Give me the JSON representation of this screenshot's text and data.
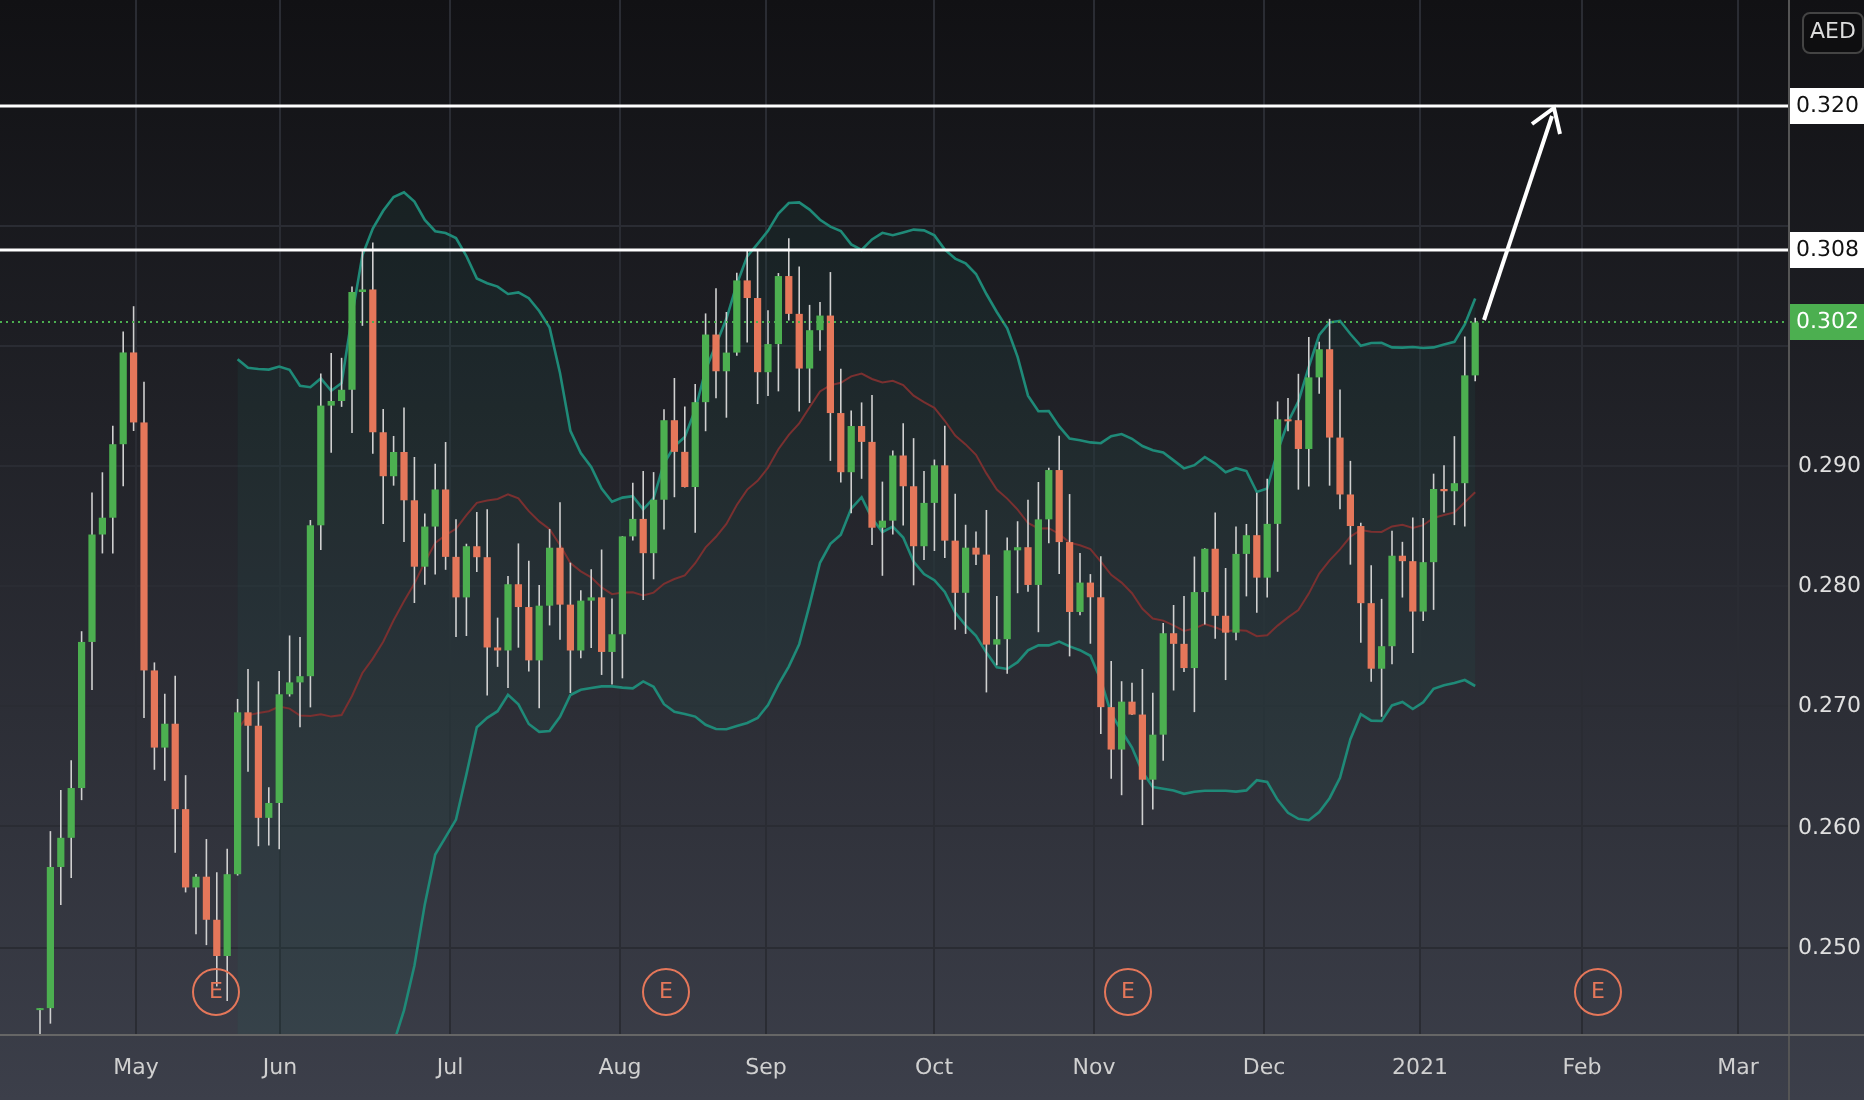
{
  "currency": "AED",
  "price_tags": [
    {
      "label": "0.320",
      "kind": "line"
    },
    {
      "label": "0.308",
      "kind": "line"
    },
    {
      "label": "0.302",
      "kind": "last"
    }
  ],
  "y_axis_labels": [
    "0.290",
    "0.280",
    "0.270",
    "0.260",
    "0.250"
  ],
  "x_axis_labels": [
    "May",
    "Jun",
    "Jul",
    "Aug",
    "Sep",
    "Oct",
    "Nov",
    "Dec",
    "2021",
    "Feb",
    "Mar"
  ],
  "events": [
    "E",
    "E",
    "E",
    "E"
  ]
}
